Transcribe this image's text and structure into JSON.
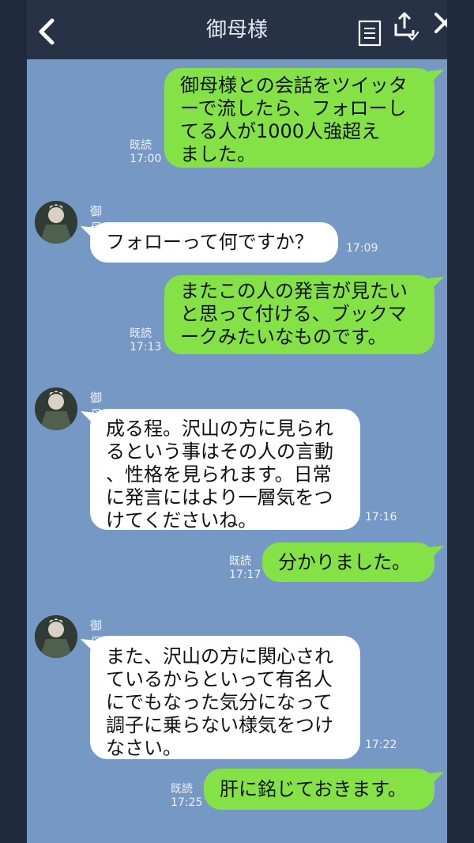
{
  "header": {
    "title": "御母様",
    "icons": [
      "back-icon",
      "menu-icon",
      "share-icon",
      "close-icon"
    ]
  },
  "colors": {
    "background": "#7698c5",
    "header": "#273246",
    "sent_bubble": "#84e247",
    "received_bubble": "#ffffff"
  },
  "messages": [
    {
      "direction": "sent",
      "read_label": "既読",
      "time": "17:00",
      "lines": [
        "御母様との会話をツイッタ",
        "ーで流したら、フォローし",
        "てる人が1000人強超え",
        "ました。"
      ]
    },
    {
      "direction": "received",
      "sender": "御母様",
      "time": "17:09",
      "lines": [
        "フォローって何ですか？"
      ]
    },
    {
      "direction": "sent",
      "read_label": "既読",
      "time": "17:13",
      "lines": [
        "またこの人の発言が見たい",
        "と思って付ける、ブックマ",
        "ークみたいなものです。"
      ]
    },
    {
      "direction": "received",
      "sender": "御母様",
      "time": "17:16",
      "lines": [
        "成る程。沢山の方に見られ",
        "るという事はその人の言動",
        "、性格を見られます。日常",
        "に発言にはより一層気をつ",
        "けてくださいね。"
      ]
    },
    {
      "direction": "sent",
      "read_label": "既読",
      "time": "17:17",
      "lines": [
        "分かりました。"
      ]
    },
    {
      "direction": "received",
      "sender": "御母様",
      "time": "17:22",
      "lines": [
        "また、沢山の方に関心され",
        "ているからといって有名人",
        "にでもなった気分になって",
        "調子に乗らない様気をつけ",
        "なさい。"
      ]
    },
    {
      "direction": "sent",
      "read_label": "既読",
      "time": "17:25",
      "lines": [
        "肝に銘じておきます。"
      ]
    }
  ]
}
